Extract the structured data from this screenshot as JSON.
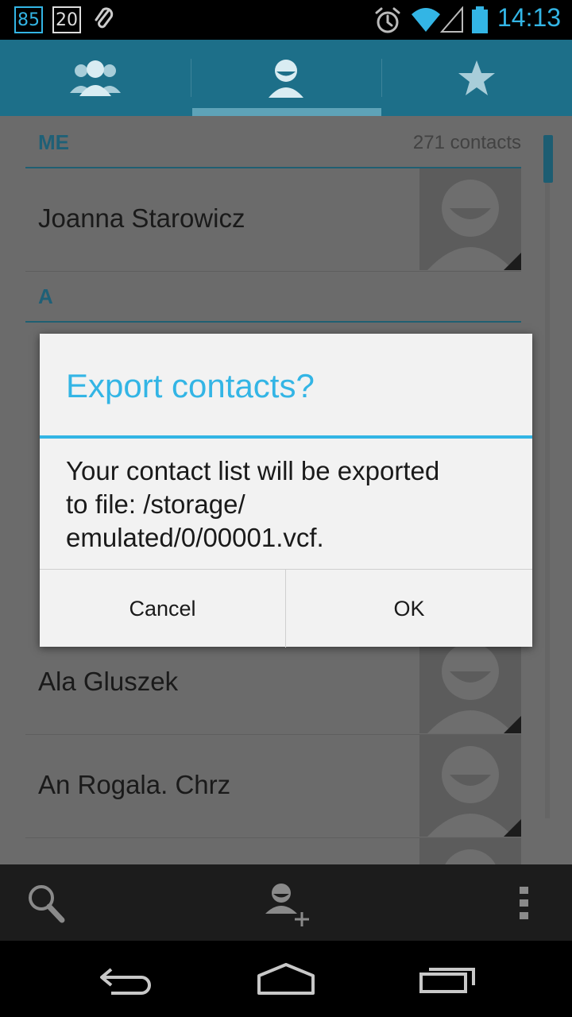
{
  "status_bar": {
    "badge_1": "85",
    "badge_2": "20",
    "time": "14:13",
    "icons": [
      "paperclip-icon",
      "alarm-icon",
      "wifi-icon",
      "signal-icon",
      "battery-icon"
    ],
    "accent_color": "#33b5e5"
  },
  "tabs": [
    {
      "name": "groups",
      "icon": "groups-icon"
    },
    {
      "name": "all-contacts",
      "icon": "person-icon",
      "selected": true
    },
    {
      "name": "favorites",
      "icon": "star-icon"
    }
  ],
  "contacts": {
    "section_me": "ME",
    "count": "271 contacts",
    "me_name": "Joanna Starowicz",
    "section_a": "A",
    "rows": [
      {
        "name": "Ala Gluszek"
      },
      {
        "name": "An Rogala. Chrz"
      }
    ]
  },
  "dialog": {
    "title": "Export contacts?",
    "message_lines": [
      "Your contact list will be exported",
      "to file: /storage/",
      "emulated/0/00001.vcf."
    ],
    "cancel_label": "Cancel",
    "ok_label": "OK"
  },
  "action_bar": {
    "icons": [
      "search-icon",
      "add-contact-icon",
      "overflow-menu-icon"
    ]
  },
  "nav_bar": {
    "icons": [
      "back-icon",
      "home-icon",
      "recents-icon"
    ]
  },
  "colors": {
    "tab_bar": "#1d6f89",
    "dialog_accent": "#33b5e5",
    "dim_overlay_content": "#6b6b6b"
  }
}
